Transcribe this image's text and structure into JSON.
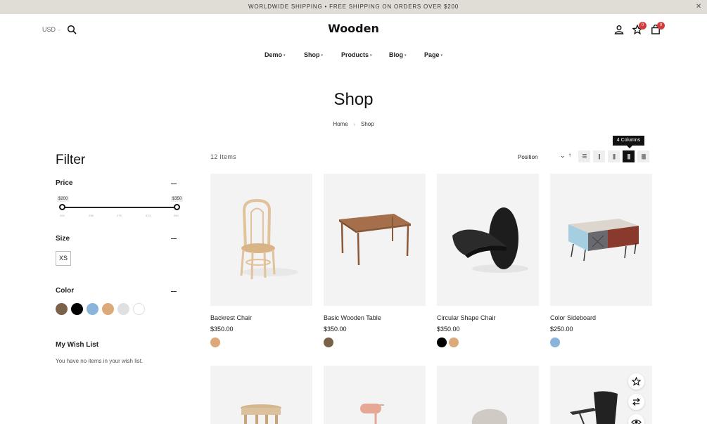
{
  "announcement": "WORLDWIDE SHIPPING • FREE SHIPPING ON ORDERS OVER $200",
  "header": {
    "currency": "USD",
    "logo": "Wooden",
    "wishlist_count": "0",
    "cart_count": "0"
  },
  "nav": [
    "Demo",
    "Shop",
    "Products",
    "Blog",
    "Page"
  ],
  "page": {
    "title": "Shop",
    "breadcrumb": [
      "Home",
      "Shop"
    ]
  },
  "filter": {
    "heading": "Filter",
    "price": {
      "label": "Price",
      "min_label": "$200",
      "max_label": "$350",
      "min_value": 200,
      "max_value": 350,
      "ticks": [
        "200",
        "238",
        "275",
        "313",
        "350"
      ]
    },
    "size": {
      "label": "Size",
      "options": [
        "XS"
      ]
    },
    "color": {
      "label": "Color",
      "swatches": [
        "#7a6149",
        "#000000",
        "#8ab4d9",
        "#dca97a",
        "#e0e0e2",
        "#ffffff"
      ]
    },
    "wishlist": {
      "label": "My Wish List",
      "empty_text": "You have no items in your wish list."
    }
  },
  "toolbar": {
    "items_count": "12 Items",
    "sort_label": "Position",
    "tooltip": "4 Columns",
    "active_view": "4 columns"
  },
  "products": [
    {
      "name": "Backrest Chair",
      "price": "$350.00",
      "swatches": [
        "#dca97a"
      ]
    },
    {
      "name": "Basic Wooden Table",
      "price": "$350.00",
      "swatches": [
        "#7a6149"
      ]
    },
    {
      "name": "Circular Shape Chair",
      "price": "$350.00",
      "swatches": [
        "#000000",
        "#dca97a"
      ]
    },
    {
      "name": "Color Sideboard",
      "price": "$250.00",
      "swatches": [
        "#8ab4d9"
      ]
    }
  ]
}
